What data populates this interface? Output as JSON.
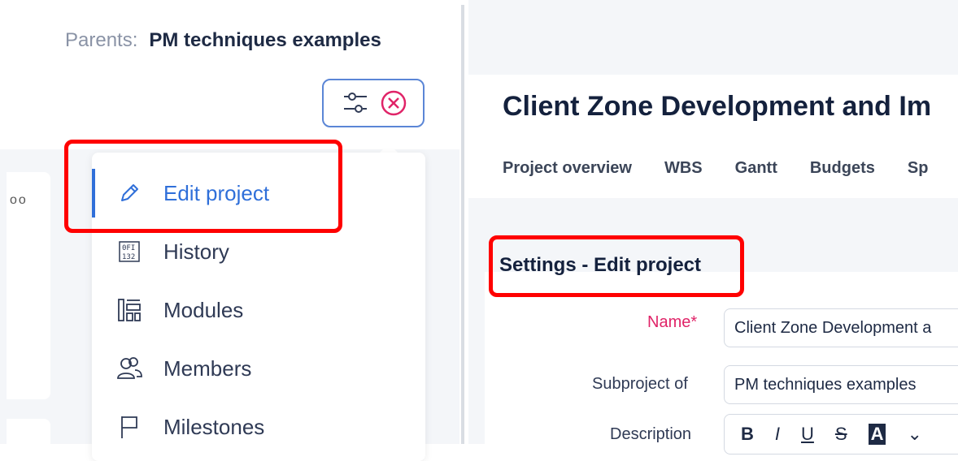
{
  "parents": {
    "label": "Parents:",
    "value": "PM techniques examples"
  },
  "toolbar": {
    "filter_icon": "sliders-icon",
    "close_icon": "close-circle-icon"
  },
  "left_card": {
    "dots": "oo"
  },
  "menu": {
    "items": [
      {
        "label": "Edit project",
        "icon": "pencil-icon"
      },
      {
        "label": "History",
        "icon": "history-icon"
      },
      {
        "label": "Modules",
        "icon": "modules-icon"
      },
      {
        "label": "Members",
        "icon": "members-icon"
      },
      {
        "label": "Milestones",
        "icon": "flag-icon"
      }
    ]
  },
  "project": {
    "title": "Client Zone Development and Im",
    "tabs": [
      "Project overview",
      "WBS",
      "Gantt",
      "Budgets",
      "Sp"
    ]
  },
  "settings": {
    "title": "Settings - Edit project",
    "fields": {
      "name_label": "Name*",
      "name_value": "Client Zone Development a",
      "subproject_label": "Subproject of",
      "subproject_value": "PM techniques examples",
      "description_label": "Description"
    },
    "editor": {
      "bold": "B",
      "italic": "I",
      "underline": "U",
      "strike": "S",
      "color": "A",
      "more": "⌄"
    }
  },
  "colors": {
    "accent": "#2f6fd9",
    "highlight": "#ff0000",
    "required": "#e02468"
  }
}
